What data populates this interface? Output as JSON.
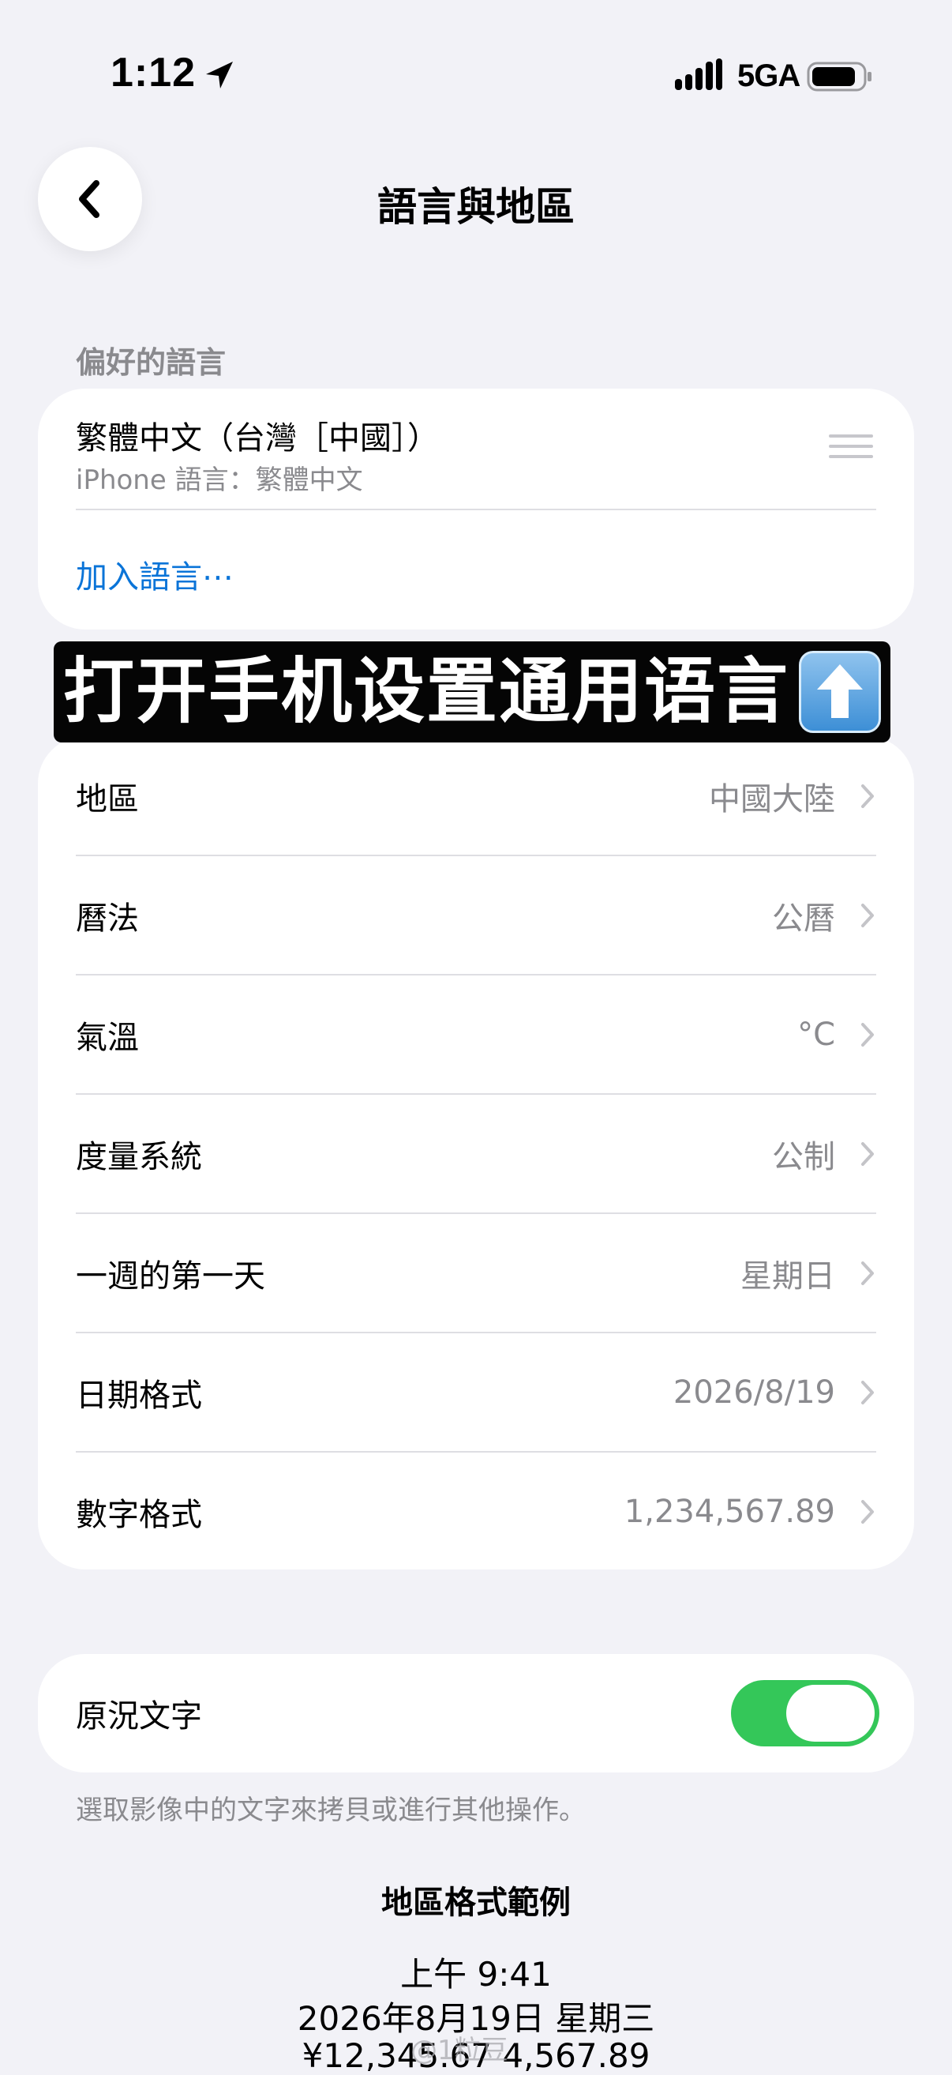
{
  "status_bar": {
    "time": "1:12",
    "network": "5GA"
  },
  "header": {
    "title": "語言與地區"
  },
  "preferred_languages": {
    "section_title": "偏好的語言",
    "language_name": "繁體中文（台灣［中國］）",
    "language_sub": "iPhone 語言：繁體中文",
    "add_language": "加入語言⋯"
  },
  "overlay_banner": {
    "text": "打开手机设置通用语言"
  },
  "region_settings": [
    {
      "label": "地區",
      "value": "中國大陸"
    },
    {
      "label": "曆法",
      "value": "公曆"
    },
    {
      "label": "氣溫",
      "value": "°C"
    },
    {
      "label": "度量系統",
      "value": "公制"
    },
    {
      "label": "一週的第一天",
      "value": "星期日"
    },
    {
      "label": "日期格式",
      "value": "2026/8/19"
    },
    {
      "label": "數字格式",
      "value": "1,234,567.89"
    }
  ],
  "live_text": {
    "label": "原況文字",
    "enabled": true,
    "footnote": "選取影像中的文字來拷貝或進行其他操作。"
  },
  "format_example": {
    "title": "地區格式範例",
    "time": "上午 9:41",
    "date": "2026年8月19日 星期三",
    "numbers": "¥12,345.67   4,567.89"
  },
  "watermark": "@1粒豆",
  "colors": {
    "background": "#f2f2f7",
    "accent_link": "#0a74d8",
    "toggle_on": "#34c759",
    "secondary_text": "#8a8a8e"
  }
}
